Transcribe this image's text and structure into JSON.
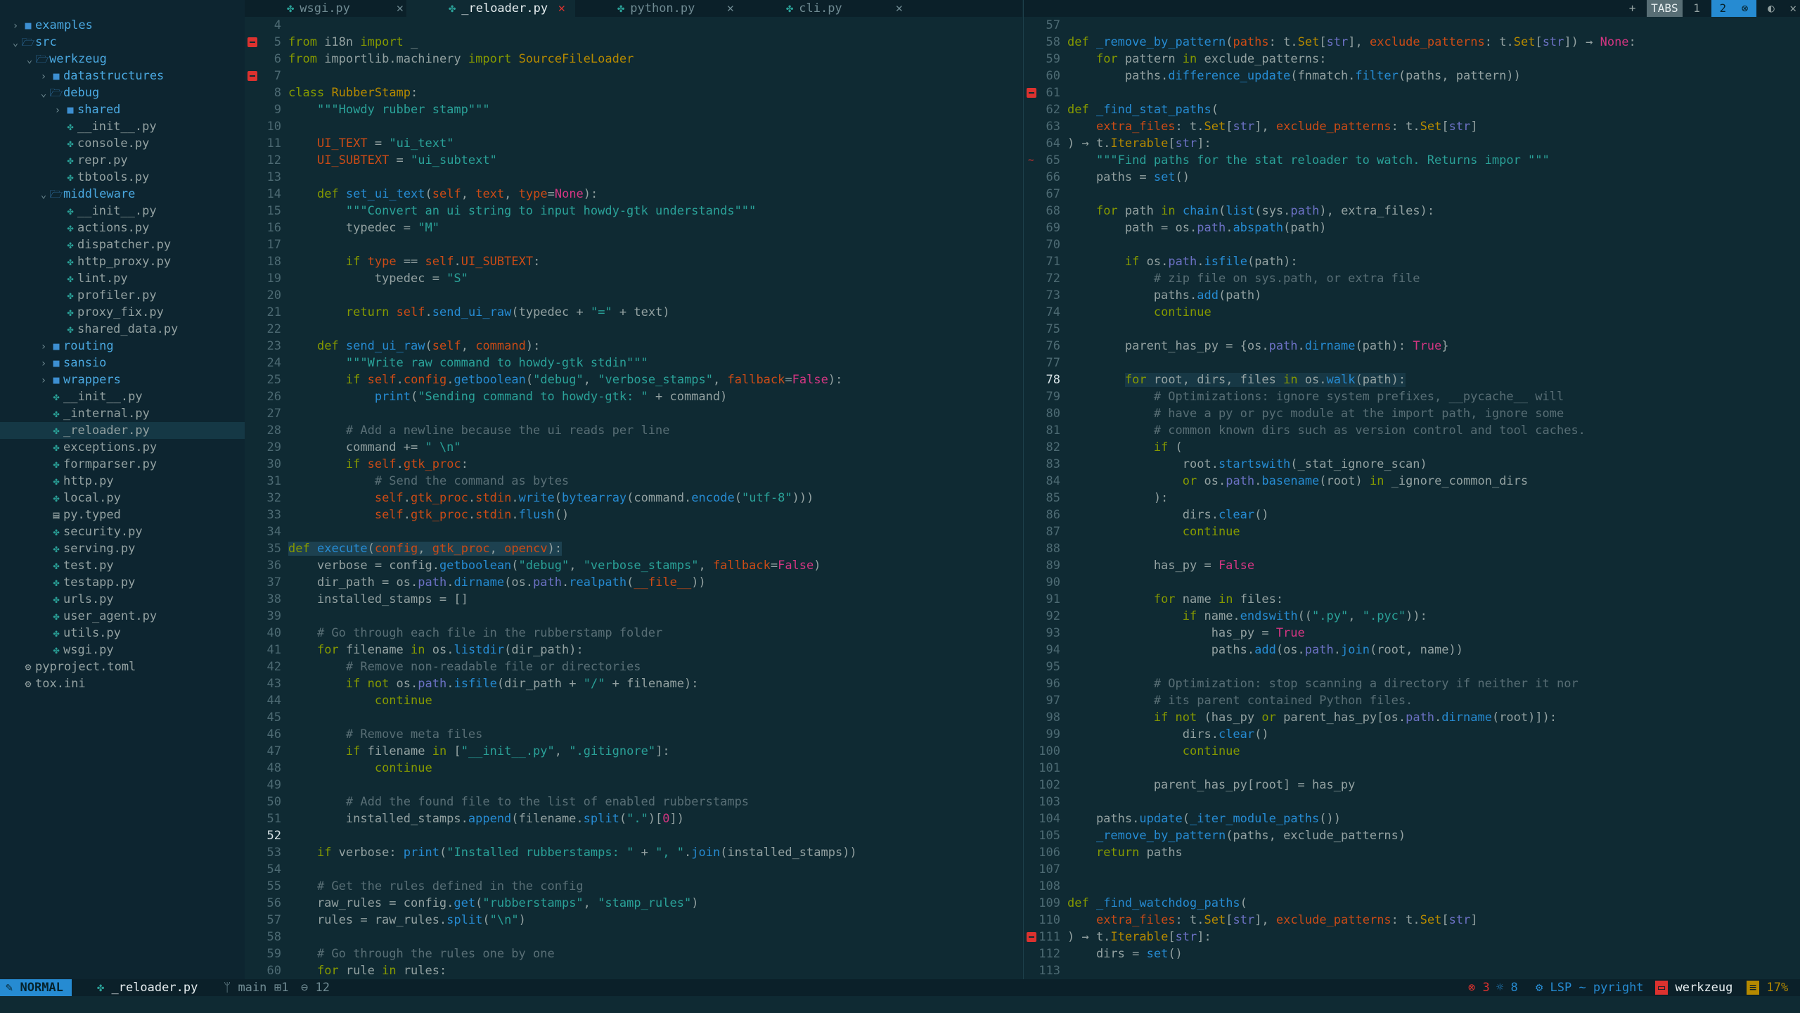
{
  "tabs": [
    {
      "label": "wsgi.py",
      "active": false
    },
    {
      "label": "_reloader.py",
      "active": true
    },
    {
      "label": "python.py",
      "active": false
    },
    {
      "label": "cli.py",
      "active": false
    }
  ],
  "tab_close": "✕",
  "tabs_indicator": {
    "plus": "+",
    "label": "TABS",
    "one": "1",
    "two": "2"
  },
  "tree": [
    {
      "depth": 0,
      "type": "dir",
      "open": false,
      "name": "examples"
    },
    {
      "depth": 0,
      "type": "dir",
      "open": true,
      "name": "src"
    },
    {
      "depth": 1,
      "type": "dir",
      "open": true,
      "name": "werkzeug"
    },
    {
      "depth": 2,
      "type": "dir",
      "open": false,
      "name": "datastructures"
    },
    {
      "depth": 2,
      "type": "dir",
      "open": true,
      "name": "debug"
    },
    {
      "depth": 3,
      "type": "dir",
      "open": false,
      "name": "shared"
    },
    {
      "depth": 3,
      "type": "py",
      "name": "__init__.py"
    },
    {
      "depth": 3,
      "type": "py",
      "name": "console.py"
    },
    {
      "depth": 3,
      "type": "py",
      "name": "repr.py"
    },
    {
      "depth": 3,
      "type": "py",
      "name": "tbtools.py"
    },
    {
      "depth": 2,
      "type": "dir",
      "open": true,
      "name": "middleware"
    },
    {
      "depth": 3,
      "type": "py",
      "name": "__init__.py"
    },
    {
      "depth": 3,
      "type": "py",
      "name": "actions.py"
    },
    {
      "depth": 3,
      "type": "py",
      "name": "dispatcher.py"
    },
    {
      "depth": 3,
      "type": "py",
      "name": "http_proxy.py"
    },
    {
      "depth": 3,
      "type": "py",
      "name": "lint.py"
    },
    {
      "depth": 3,
      "type": "py",
      "name": "profiler.py"
    },
    {
      "depth": 3,
      "type": "py",
      "name": "proxy_fix.py"
    },
    {
      "depth": 3,
      "type": "py",
      "name": "shared_data.py"
    },
    {
      "depth": 2,
      "type": "dir",
      "open": false,
      "name": "routing"
    },
    {
      "depth": 2,
      "type": "dir",
      "open": false,
      "name": "sansio"
    },
    {
      "depth": 2,
      "type": "dir",
      "open": false,
      "name": "wrappers"
    },
    {
      "depth": 2,
      "type": "py",
      "name": "__init__.py"
    },
    {
      "depth": 2,
      "type": "py",
      "name": "_internal.py"
    },
    {
      "depth": 2,
      "type": "py",
      "name": "_reloader.py",
      "selected": true
    },
    {
      "depth": 2,
      "type": "py",
      "name": "exceptions.py"
    },
    {
      "depth": 2,
      "type": "py",
      "name": "formparser.py"
    },
    {
      "depth": 2,
      "type": "py",
      "name": "http.py"
    },
    {
      "depth": 2,
      "type": "py",
      "name": "local.py"
    },
    {
      "depth": 2,
      "type": "file",
      "name": "py.typed"
    },
    {
      "depth": 2,
      "type": "py",
      "name": "security.py"
    },
    {
      "depth": 2,
      "type": "py",
      "name": "serving.py"
    },
    {
      "depth": 2,
      "type": "py",
      "name": "test.py"
    },
    {
      "depth": 2,
      "type": "py",
      "name": "testapp.py"
    },
    {
      "depth": 2,
      "type": "py",
      "name": "urls.py"
    },
    {
      "depth": 2,
      "type": "py",
      "name": "user_agent.py"
    },
    {
      "depth": 2,
      "type": "py",
      "name": "utils.py"
    },
    {
      "depth": 2,
      "type": "py",
      "name": "wsgi.py"
    },
    {
      "depth": 0,
      "type": "gear",
      "name": "pyproject.toml"
    },
    {
      "depth": 0,
      "type": "gear",
      "name": "tox.ini"
    }
  ],
  "left_code": [
    {
      "n": "4",
      "t": ""
    },
    {
      "n": "5",
      "t": "<span class='k'>from</span> i18n <span class='k'>import</span> _",
      "sign": "err"
    },
    {
      "n": "6",
      "t": "<span class='k'>from</span> importlib.machinery <span class='k'>import</span> <span class='cls'>SourceFileLoader</span>"
    },
    {
      "n": "7",
      "t": "",
      "sign": "err"
    },
    {
      "n": "8",
      "t": "<span class='k'>class</span> <span class='cls'>RubberStamp</span>:"
    },
    {
      "n": "9",
      "t": "    <span class='s'>\"\"\"Howdy rubber stamp\"\"\"</span>"
    },
    {
      "n": "10",
      "t": ""
    },
    {
      "n": "11",
      "t": "    <span class='sf'>UI_TEXT</span> = <span class='s'>\"ui_text\"</span>"
    },
    {
      "n": "12",
      "t": "    <span class='sf'>UI_SUBTEXT</span> = <span class='s'>\"ui_subtext\"</span>"
    },
    {
      "n": "13",
      "t": ""
    },
    {
      "n": "14",
      "t": "    <span class='k'>def</span> <span class='f'>set_ui_text</span>(<span class='sf'>self</span>, <span class='sf'>text</span>, <span class='sf'>type</span>=<span class='n'>None</span>):"
    },
    {
      "n": "15",
      "t": "        <span class='s'>\"\"\"Convert an ui string to input howdy-gtk understands\"\"\"</span>"
    },
    {
      "n": "16",
      "t": "        typedec = <span class='s'>\"M\"</span>"
    },
    {
      "n": "17",
      "t": ""
    },
    {
      "n": "18",
      "t": "        <span class='k'>if</span> <span class='sf'>type</span> == <span class='sf'>self</span>.<span class='sf'>UI_SUBTEXT</span>:"
    },
    {
      "n": "19",
      "t": "            typedec = <span class='s'>\"S\"</span>"
    },
    {
      "n": "20",
      "t": ""
    },
    {
      "n": "21",
      "t": "        <span class='k'>return</span> <span class='sf'>self</span>.<span class='f'>send_ui_raw</span>(typedec + <span class='s'>\"=\"</span> + text)"
    },
    {
      "n": "22",
      "t": ""
    },
    {
      "n": "23",
      "t": "    <span class='k'>def</span> <span class='f'>send_ui_raw</span>(<span class='sf'>self</span>, <span class='sf'>command</span>):"
    },
    {
      "n": "24",
      "t": "        <span class='s'>\"\"\"Write raw command to howdy-gtk stdin\"\"\"</span>"
    },
    {
      "n": "25",
      "t": "        <span class='k'>if</span> <span class='sf'>self</span>.<span class='sf'>config</span>.<span class='f'>getboolean</span>(<span class='s'>\"debug\"</span>, <span class='s'>\"verbose_stamps\"</span>, <span class='sf'>fallback</span>=<span class='n'>False</span>):"
    },
    {
      "n": "26",
      "t": "            <span class='f'>print</span>(<span class='s'>\"Sending command to howdy-gtk: \"</span> + command)"
    },
    {
      "n": "27",
      "t": ""
    },
    {
      "n": "28",
      "t": "        <span class='c'># Add a newline because the ui reads per line</span>"
    },
    {
      "n": "29",
      "t": "        command += <span class='s'>\" \\n\"</span>"
    },
    {
      "n": "30",
      "t": "        <span class='k'>if</span> <span class='sf'>self</span>.<span class='sf'>gtk_proc</span>:"
    },
    {
      "n": "31",
      "t": "            <span class='c'># Send the command as bytes</span>"
    },
    {
      "n": "32",
      "t": "            <span class='sf'>self</span>.<span class='sf'>gtk_proc</span>.<span class='sf'>stdin</span>.<span class='f'>write</span>(<span class='f'>bytearray</span>(command.<span class='f'>encode</span>(<span class='s'>\"utf-8\"</span>)))"
    },
    {
      "n": "33",
      "t": "            <span class='sf'>self</span>.<span class='sf'>gtk_proc</span>.<span class='sf'>stdin</span>.<span class='f'>flush</span>()"
    },
    {
      "n": "34",
      "t": ""
    },
    {
      "n": "35",
      "t": "<span class='hl-fn'><span class='k'>def</span> <span class='f'>execute</span>(<span class='sf'>config</span>, <span class='sf'>gtk_proc</span>, <span class='sf'>opencv</span>):</span>"
    },
    {
      "n": "36",
      "t": "    verbose = config.<span class='f'>getboolean</span>(<span class='s'>\"debug\"</span>, <span class='s'>\"verbose_stamps\"</span>, <span class='sf'>fallback</span>=<span class='n'>False</span>)"
    },
    {
      "n": "37",
      "t": "    dir_path = os.<span class='bi'>path</span>.<span class='f'>dirname</span>(os.<span class='bi'>path</span>.<span class='f'>realpath</span>(<span class='sf'>__file__</span>))"
    },
    {
      "n": "38",
      "t": "    installed_stamps = []"
    },
    {
      "n": "39",
      "t": ""
    },
    {
      "n": "40",
      "t": "    <span class='c'># Go through each file in the rubberstamp folder</span>"
    },
    {
      "n": "41",
      "t": "    <span class='k'>for</span> filename <span class='k'>in</span> os.<span class='f'>listdir</span>(dir_path):"
    },
    {
      "n": "42",
      "t": "        <span class='c'># Remove non-readable file or directories</span>"
    },
    {
      "n": "43",
      "t": "        <span class='k'>if not</span> os.<span class='bi'>path</span>.<span class='f'>isfile</span>(dir_path + <span class='s'>\"/\"</span> + filename):"
    },
    {
      "n": "44",
      "t": "            <span class='k'>continue</span>"
    },
    {
      "n": "45",
      "t": ""
    },
    {
      "n": "46",
      "t": "        <span class='c'># Remove meta files</span>"
    },
    {
      "n": "47",
      "t": "        <span class='k'>if</span> filename <span class='k'>in</span> [<span class='s'>\"__init__.py\"</span>, <span class='s'>\".gitignore\"</span>]:"
    },
    {
      "n": "48",
      "t": "            <span class='k'>continue</span>"
    },
    {
      "n": "49",
      "t": ""
    },
    {
      "n": "50",
      "t": "        <span class='c'># Add the found file to the list of enabled rubberstamps</span>"
    },
    {
      "n": "51",
      "t": "        installed_stamps.<span class='f'>append</span>(filename.<span class='f'>split</span>(<span class='s'>\".\"</span>)[<span class='n'>0</span>])"
    },
    {
      "n": "52",
      "t": "",
      "cur": true
    },
    {
      "n": "53",
      "t": "    <span class='k'>if</span> verbose: <span class='f'>print</span>(<span class='s'>\"Installed rubberstamps: \"</span> + <span class='s'>\", \"</span>.<span class='f'>join</span>(installed_stamps))"
    },
    {
      "n": "54",
      "t": ""
    },
    {
      "n": "55",
      "t": "    <span class='c'># Get the rules defined in the config</span>"
    },
    {
      "n": "56",
      "t": "    raw_rules = config.<span class='f'>get</span>(<span class='s'>\"rubberstamps\"</span>, <span class='s'>\"stamp_rules\"</span>)"
    },
    {
      "n": "57",
      "t": "    rules = raw_rules.<span class='f'>split</span>(<span class='s'>\"\\n\"</span>)"
    },
    {
      "n": "58",
      "t": ""
    },
    {
      "n": "59",
      "t": "    <span class='c'># Go through the rules one by one</span>"
    },
    {
      "n": "60",
      "t": "    <span class='k'>for</span> rule <span class='k'>in</span> rules:"
    }
  ],
  "right_code": [
    {
      "n": "57",
      "t": ""
    },
    {
      "n": "58",
      "t": "<span class='k'>def</span> <span class='f'>_remove_by_pattern</span>(<span class='sf'>paths</span>: t.<span class='cls'>Set</span>[<span class='bi'>str</span>], <span class='sf'>exclude_patterns</span>: t.<span class='cls'>Set</span>[<span class='bi'>str</span>]) → <span class='n'>None</span>:"
    },
    {
      "n": "59",
      "t": "    <span class='k'>for</span> pattern <span class='k'>in</span> exclude_patterns:"
    },
    {
      "n": "60",
      "t": "        paths.<span class='f'>difference_update</span>(fnmatch.<span class='f'>filter</span>(paths, pattern))"
    },
    {
      "n": "61",
      "t": "",
      "sign": "err"
    },
    {
      "n": "62",
      "t": "<span class='k'>def</span> <span class='f'>_find_stat_paths</span>("
    },
    {
      "n": "63",
      "t": "    <span class='sf'>extra_files</span>: t.<span class='cls'>Set</span>[<span class='bi'>str</span>], <span class='sf'>exclude_patterns</span>: t.<span class='cls'>Set</span>[<span class='bi'>str</span>]"
    },
    {
      "n": "64",
      "t": ") → t.<span class='cls'>Iterable</span>[<span class='bi'>str</span>]:"
    },
    {
      "n": "65",
      "t": "    <span class='s'>\"\"\"Find paths for the stat reloader to watch. Returns impor \"\"\"</span>",
      "sign": "warn"
    },
    {
      "n": "66",
      "t": "    paths = <span class='f'>set</span>()"
    },
    {
      "n": "67",
      "t": ""
    },
    {
      "n": "68",
      "t": "    <span class='k'>for</span> path <span class='k'>in</span> <span class='f'>chain</span>(<span class='f'>list</span>(sys.<span class='bi'>path</span>), extra_files):"
    },
    {
      "n": "69",
      "t": "        path = os.<span class='bi'>path</span>.<span class='f'>abspath</span>(path)"
    },
    {
      "n": "70",
      "t": ""
    },
    {
      "n": "71",
      "t": "        <span class='k'>if</span> os.<span class='bi'>path</span>.<span class='f'>isfile</span>(path):"
    },
    {
      "n": "72",
      "t": "            <span class='c'># zip file on sys.path, or extra file</span>"
    },
    {
      "n": "73",
      "t": "            paths.<span class='f'>add</span>(path)"
    },
    {
      "n": "74",
      "t": "            <span class='k'>continue</span>"
    },
    {
      "n": "75",
      "t": ""
    },
    {
      "n": "76",
      "t": "        parent_has_py = {os.<span class='bi'>path</span>.<span class='f'>dirname</span>(path): <span class='n'>True</span>}"
    },
    {
      "n": "77",
      "t": ""
    },
    {
      "n": "78",
      "t": "        <span class='hl-line'><span class='k'>for</span> root, dirs, files <span class='k'>in</span> os.<span class='f'>walk</span>(path):</span>",
      "cur": true
    },
    {
      "n": "79",
      "t": "            <span class='c'># Optimizations: ignore system prefixes, __pycache__ will</span>"
    },
    {
      "n": "80",
      "t": "            <span class='c'># have a py or pyc module at the import path, ignore some</span>"
    },
    {
      "n": "81",
      "t": "            <span class='c'># common known dirs such as version control and tool caches.</span>"
    },
    {
      "n": "82",
      "t": "            <span class='k'>if</span> ("
    },
    {
      "n": "83",
      "t": "                root.<span class='f'>startswith</span>(_stat_ignore_scan)"
    },
    {
      "n": "84",
      "t": "                <span class='k'>or</span> os.<span class='bi'>path</span>.<span class='f'>basename</span>(root) <span class='k'>in</span> _ignore_common_dirs"
    },
    {
      "n": "85",
      "t": "            ):"
    },
    {
      "n": "86",
      "t": "                dirs.<span class='f'>clear</span>()"
    },
    {
      "n": "87",
      "t": "                <span class='k'>continue</span>"
    },
    {
      "n": "88",
      "t": ""
    },
    {
      "n": "89",
      "t": "            has_py = <span class='n'>False</span>"
    },
    {
      "n": "90",
      "t": ""
    },
    {
      "n": "91",
      "t": "            <span class='k'>for</span> name <span class='k'>in</span> files:"
    },
    {
      "n": "92",
      "t": "                <span class='k'>if</span> name.<span class='f'>endswith</span>((<span class='s'>\".py\"</span>, <span class='s'>\".pyc\"</span>)):"
    },
    {
      "n": "93",
      "t": "                    has_py = <span class='n'>True</span>"
    },
    {
      "n": "94",
      "t": "                    paths.<span class='f'>add</span>(os.<span class='bi'>path</span>.<span class='f'>join</span>(root, name))"
    },
    {
      "n": "95",
      "t": ""
    },
    {
      "n": "96",
      "t": "            <span class='c'># Optimization: stop scanning a directory if neither it nor</span>"
    },
    {
      "n": "97",
      "t": "            <span class='c'># its parent contained Python files.</span>"
    },
    {
      "n": "98",
      "t": "            <span class='k'>if not</span> (has_py <span class='k'>or</span> parent_has_py[os.<span class='bi'>path</span>.<span class='f'>dirname</span>(root)]):"
    },
    {
      "n": "99",
      "t": "                dirs.<span class='f'>clear</span>()"
    },
    {
      "n": "100",
      "t": "                <span class='k'>continue</span>"
    },
    {
      "n": "101",
      "t": ""
    },
    {
      "n": "102",
      "t": "            parent_has_py[root] = has_py"
    },
    {
      "n": "103",
      "t": ""
    },
    {
      "n": "104",
      "t": "    paths.<span class='f'>update</span>(<span class='f'>_iter_module_paths</span>())"
    },
    {
      "n": "105",
      "t": "    <span class='f'>_remove_by_pattern</span>(paths, exclude_patterns)"
    },
    {
      "n": "106",
      "t": "    <span class='k'>return</span> paths"
    },
    {
      "n": "107",
      "t": ""
    },
    {
      "n": "108",
      "t": ""
    },
    {
      "n": "109",
      "t": "<span class='k'>def</span> <span class='f'>_find_watchdog_paths</span>("
    },
    {
      "n": "110",
      "t": "    <span class='sf'>extra_files</span>: t.<span class='cls'>Set</span>[<span class='bi'>str</span>], <span class='sf'>exclude_patterns</span>: t.<span class='cls'>Set</span>[<span class='bi'>str</span>]"
    },
    {
      "n": "111",
      "t": ") → t.<span class='cls'>Iterable</span>[<span class='bi'>str</span>]:",
      "sign": "err"
    },
    {
      "n": "112",
      "t": "    dirs = <span class='f'>set</span>()"
    },
    {
      "n": "113",
      "t": ""
    }
  ],
  "status": {
    "mode": "NORMAL",
    "file": "_reloader.py",
    "branch": "main",
    "added": "1",
    "changed": "12",
    "errors": "3",
    "hints": "8",
    "lsp": "LSP ~ pyright",
    "project": "werkzeug",
    "percent": "17%"
  },
  "colors": {
    "accent": "#268bd2",
    "bg": "#0f2a33",
    "error": "#dc322f",
    "string": "#2aa198",
    "keyword": "#859900"
  }
}
